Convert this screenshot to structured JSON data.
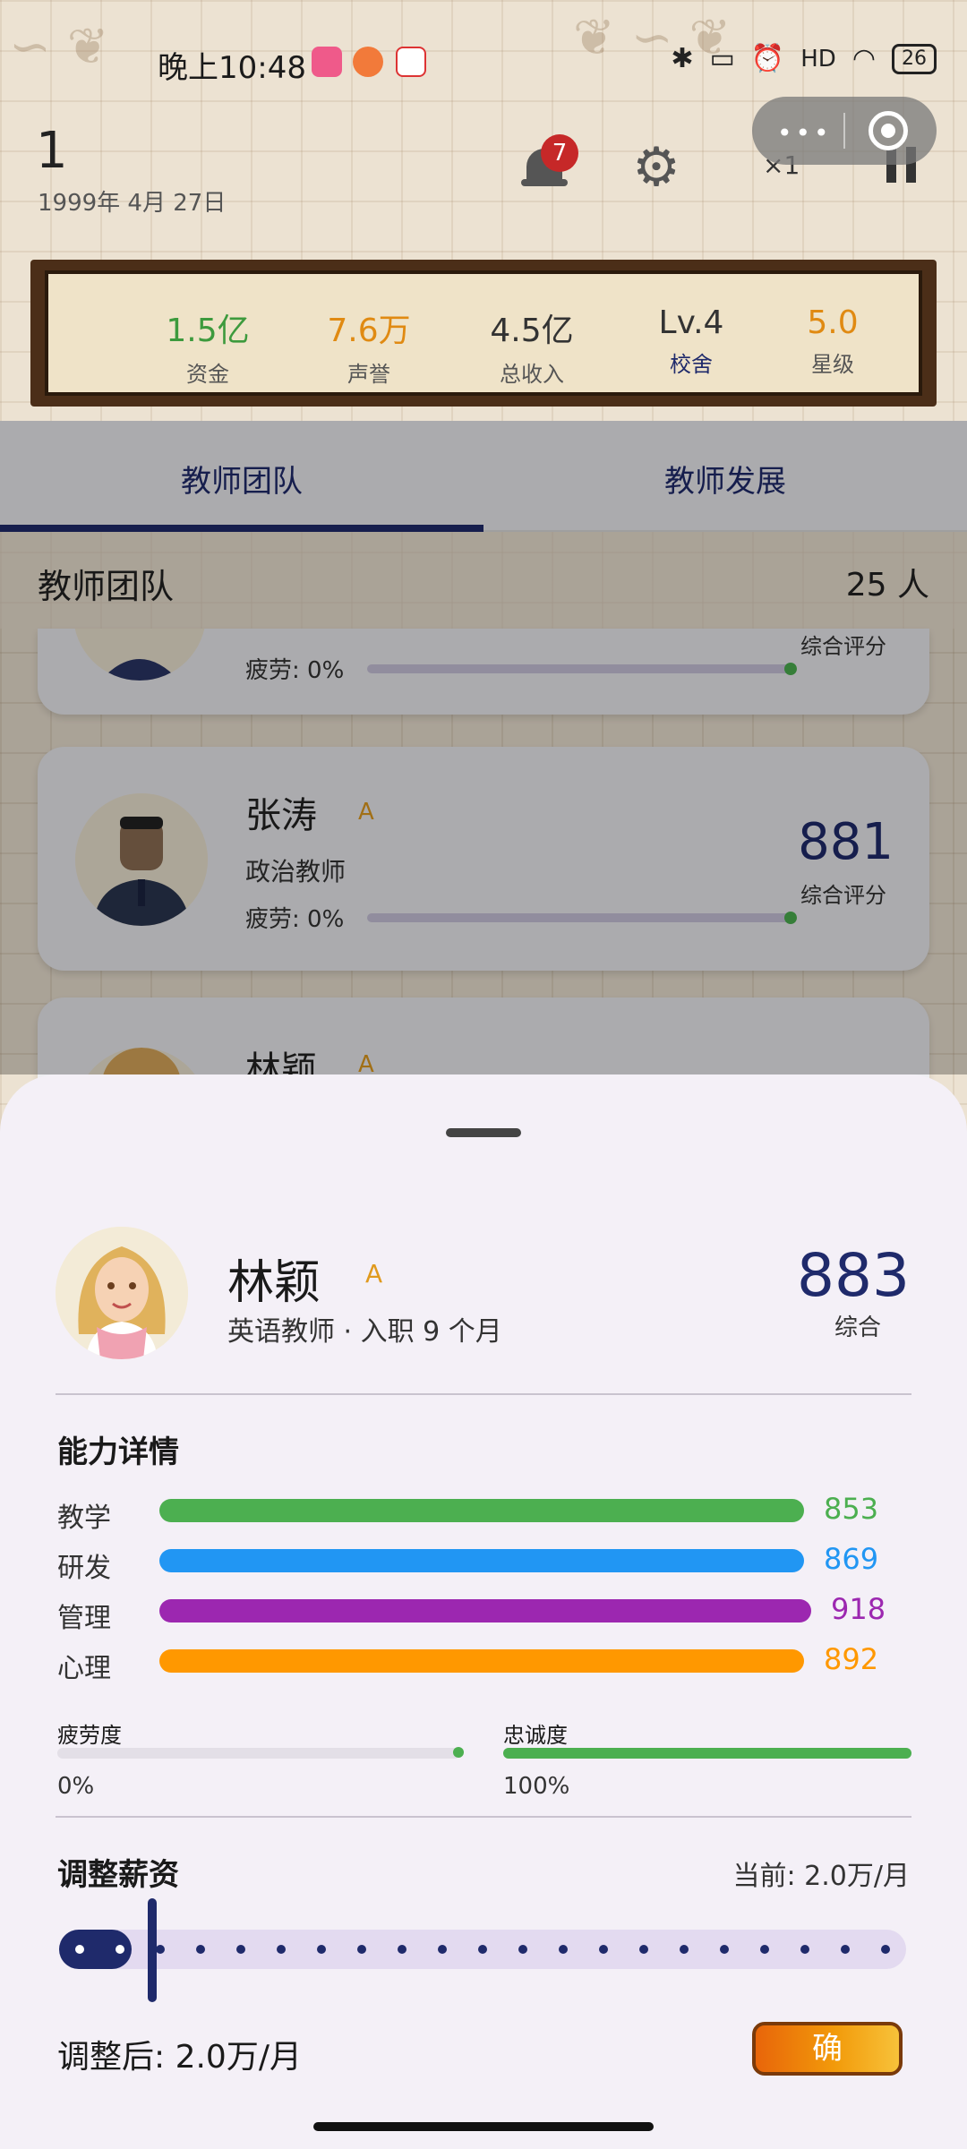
{
  "status_bar": {
    "time": "晚上10:48",
    "battery": "26",
    "signal": "HD"
  },
  "header": {
    "level": "1",
    "date": "1999年 4月 27日",
    "notification_count": "7",
    "speed": "×1"
  },
  "stats": [
    {
      "value": "1.5亿",
      "label": "资金",
      "value_color": "#3d9a3d",
      "label_color": "#555555"
    },
    {
      "value": "7.6万",
      "label": "声誉",
      "value_color": "#e08a12",
      "label_color": "#555555"
    },
    {
      "value": "4.5亿",
      "label": "总收入",
      "value_color": "#333333",
      "label_color": "#555555"
    },
    {
      "value": "Lv.4",
      "label": "校舍",
      "value_color": "#333333",
      "label_color": "#1f2a6b"
    },
    {
      "value": "5.0",
      "label": "星级",
      "value_color": "#e08a12",
      "label_color": "#555555"
    }
  ],
  "tabs": [
    {
      "label": "教师团队",
      "active": true
    },
    {
      "label": "教师发展",
      "active": false
    }
  ],
  "team": {
    "title": "教师团队",
    "count": "25 人"
  },
  "cards": [
    {
      "name": "",
      "grade": "",
      "role": "",
      "fatigue_label": "疲劳: 0%",
      "fatigue": 0,
      "score": "",
      "score_label": "综合评分"
    },
    {
      "name": "张涛",
      "grade": "A",
      "role": "政治教师",
      "fatigue_label": "疲劳: 0%",
      "fatigue": 0,
      "score": "881",
      "score_label": "综合评分"
    },
    {
      "name": "林颖",
      "grade": "A",
      "role": "",
      "fatigue_label": "",
      "fatigue": 0,
      "score": "",
      "score_label": ""
    }
  ],
  "detail": {
    "name": "林颖",
    "grade": "A",
    "subtitle": "英语教师 · 入职 9 个月",
    "score": "883",
    "score_label": "综合",
    "abilities_title": "能力详情",
    "abilities": [
      {
        "label": "教学",
        "value": "853",
        "color": "#4caf50",
        "fraction": 0.93
      },
      {
        "label": "研发",
        "value": "869",
        "color": "#2196f3",
        "fraction": 0.93
      },
      {
        "label": "管理",
        "value": "918",
        "color": "#9c27b0",
        "fraction": 0.94
      },
      {
        "label": "心理",
        "value": "892",
        "color": "#ff9800",
        "fraction": 0.93
      }
    ],
    "fatigue": {
      "label": "疲劳度",
      "value": "0%",
      "fraction": 0
    },
    "loyalty": {
      "label": "忠诚度",
      "value": "100%",
      "fraction": 1.0
    },
    "salary_title": "调整薪资",
    "salary_current": "当前: 2.0万/月",
    "salary_after": "调整后: 2.0万/月",
    "salary_fraction": 0.1,
    "confirm_label": "确"
  }
}
